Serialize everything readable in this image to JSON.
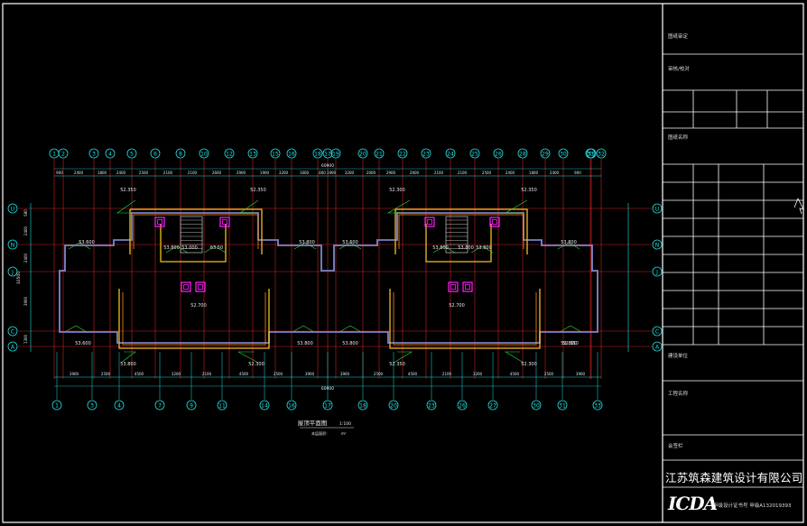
{
  "title_block": {
    "field_1": "图纸审定",
    "field_2": "审核/校对",
    "field_3": "图纸名称",
    "field_4": "建设单位",
    "field_5": "工程名称",
    "field_6": "会签栏",
    "company": "江苏筑森建筑设计有限公司",
    "logo": "ICDA",
    "cert": "甲级设计证书号  甲级A132019393"
  },
  "drawing": {
    "title": "屋顶平面图",
    "scale": "1:100",
    "subtitle": "本层面积：",
    "subtitle_value": "m²"
  },
  "axes_top": [
    "1",
    "2",
    "3",
    "4",
    "5",
    "6",
    "8",
    "10",
    "12",
    "13",
    "15",
    "16",
    "18",
    "17",
    "19",
    "20",
    "21",
    "22",
    "23",
    "24",
    "25",
    "26",
    "28",
    "29",
    "30",
    "31",
    "32",
    "33"
  ],
  "axes_bottom": [
    "1",
    "3",
    "4",
    "7",
    "9",
    "11",
    "14",
    "16",
    "17",
    "18",
    "20",
    "23",
    "26",
    "27",
    "30",
    "31",
    "33"
  ],
  "axes_left": [
    "U",
    "N",
    "J",
    "C",
    "A"
  ],
  "axes_right": [
    "U",
    "N",
    "J",
    "C",
    "A"
  ],
  "top_dims": [
    "900",
    "2400",
    "1800",
    "2400",
    "2500",
    "2100",
    "2100",
    "2600",
    "2900",
    "1900",
    "3200",
    "1600",
    "800",
    "1900",
    "3200",
    "2000",
    "2900",
    "2600",
    "2100",
    "2100",
    "2500",
    "2400",
    "1800",
    "2400",
    "900"
  ],
  "top_total": "60900",
  "bottom_dims": [
    "3900",
    "2500",
    "4500",
    "3200",
    "2100",
    "4500",
    "2500",
    "3900",
    "3900",
    "2500",
    "4500",
    "2100",
    "3200",
    "4500",
    "2500",
    "3900"
  ],
  "bottom_total": "60900",
  "left_dims": [
    "580",
    "2400",
    "2400",
    "3900",
    "1300"
  ],
  "left_total": "10500",
  "elevations": [
    "52.350",
    "52.350",
    "52.300",
    "52.350",
    "53.600",
    "53.800",
    "53.600",
    "63.50",
    "53.800",
    "53.800",
    "53.800",
    "53.800",
    "53.800",
    "53.000",
    "53.600",
    "52.700",
    "52.700",
    "53.800",
    "53.800",
    "53.800",
    "53.800",
    "52.300",
    "52.350",
    "52.300",
    "52.350"
  ]
}
